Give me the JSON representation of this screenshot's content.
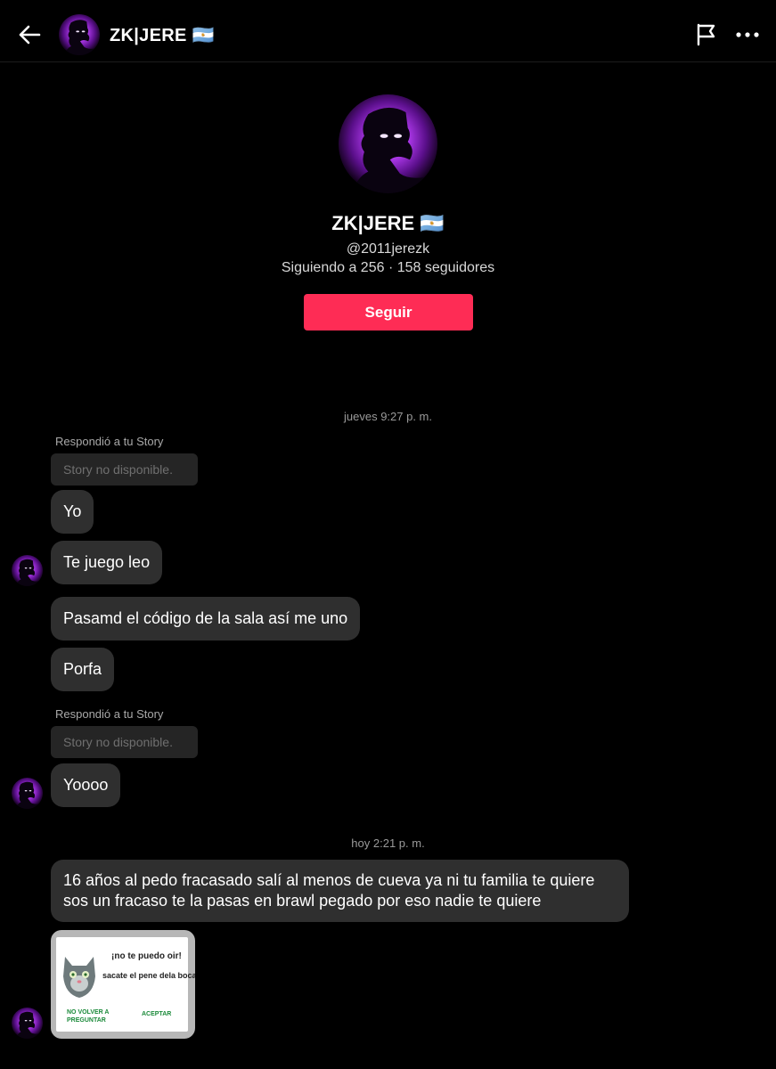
{
  "header": {
    "name": "ZK|JERE 🇦🇷",
    "back_icon": "arrow-left-icon",
    "report_icon": "flag-icon",
    "more_icon": "more-horizontal-icon"
  },
  "profile": {
    "name": "ZK|JERE 🇦🇷",
    "handle": "@2011jerezk",
    "stats": "Siguiendo a 256 · 158 seguidores",
    "follow_label": "Seguir"
  },
  "colors": {
    "background": "#000000",
    "accent": "#fe2c55",
    "bubble": "#2f2f2f",
    "avatar_glow": "#c23bff"
  },
  "chat": {
    "timestamp1": "jueves 9:27 p. m.",
    "reply_note1": "Respondió a tu Story",
    "story_unavailable1": "Story no disponible.",
    "msg1": "Yo",
    "msg2": "Te juego leo",
    "msg3": "Pasamd el código de la sala así me uno",
    "msg4": "Porfa",
    "reply_note2": "Respondió a tu Story",
    "story_unavailable2": "Story no disponible.",
    "msg5": "Yoooo",
    "timestamp2": "hoy 2:21 p. m.",
    "msg6_line1": "16 años al pedo fracasado salí al menos de cueva ya ni tu familia te quiere",
    "msg6_line2": "sos un fracaso te la pasas en brawl pegado por eso nadie te quiere",
    "image_msg": {
      "title": "¡no te puedo oir!",
      "subtitle": "sacate el pene dela boca",
      "button_left": "NO VOLVER A PREGUNTAR",
      "button_right": "ACEPTAR"
    }
  }
}
